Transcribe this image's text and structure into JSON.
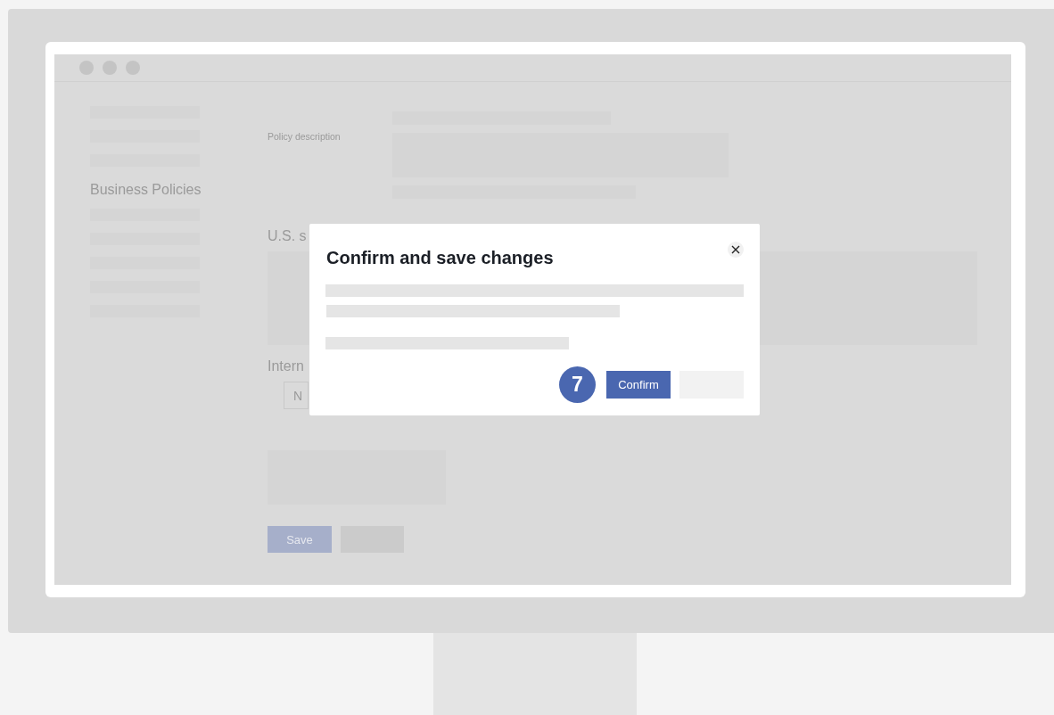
{
  "sidebar": {
    "items": [
      {
        "kind": "placeholder"
      },
      {
        "kind": "placeholder"
      },
      {
        "kind": "placeholder"
      },
      {
        "kind": "label",
        "label": "Business Policies"
      },
      {
        "kind": "placeholder"
      },
      {
        "kind": "placeholder"
      },
      {
        "kind": "placeholder"
      },
      {
        "kind": "placeholder"
      },
      {
        "kind": "placeholder"
      }
    ]
  },
  "form": {
    "description_label": "Policy description",
    "us_heading": "U.S. s",
    "international_heading": "Intern",
    "international_select": "N",
    "save_button": {
      "label": "Save",
      "disabled": true
    }
  },
  "dialog": {
    "title": "Confirm and save changes",
    "step_badge": "7",
    "confirm_button": "Confirm"
  }
}
